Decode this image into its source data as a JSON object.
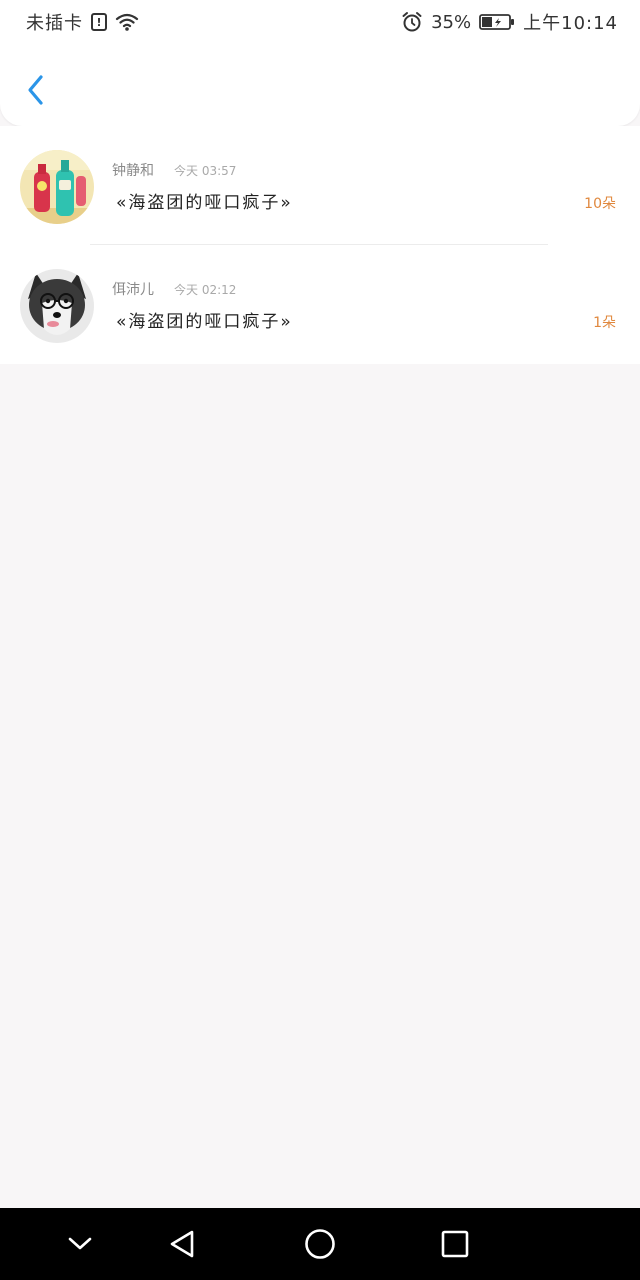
{
  "status_bar": {
    "carrier": "未插卡",
    "battery": "35%",
    "time": "上午10:14",
    "icons": [
      "sim-alert-icon",
      "wifi-icon",
      "alarm-icon",
      "battery-icon"
    ]
  },
  "header": {
    "back_icon": "chevron-left-icon",
    "accent_color": "#2b95e8"
  },
  "list": {
    "items": [
      {
        "name": "钟静和",
        "time": "今天 03:57",
        "title": "«海盗团的哑口疯子»",
        "count": "10朵",
        "avatar": "bottles-avatar"
      },
      {
        "name": "佴沛儿",
        "time": "今天 02:12",
        "title": "«海盗团的哑口疯子»",
        "count": "1朵",
        "avatar": "husky-avatar"
      }
    ]
  },
  "colors": {
    "count_color": "#e0883e",
    "background": "#f8f6f7"
  },
  "nav_bar": {
    "icons": [
      "chevron-down-icon",
      "back-triangle-icon",
      "home-circle-icon",
      "recents-square-icon"
    ]
  }
}
